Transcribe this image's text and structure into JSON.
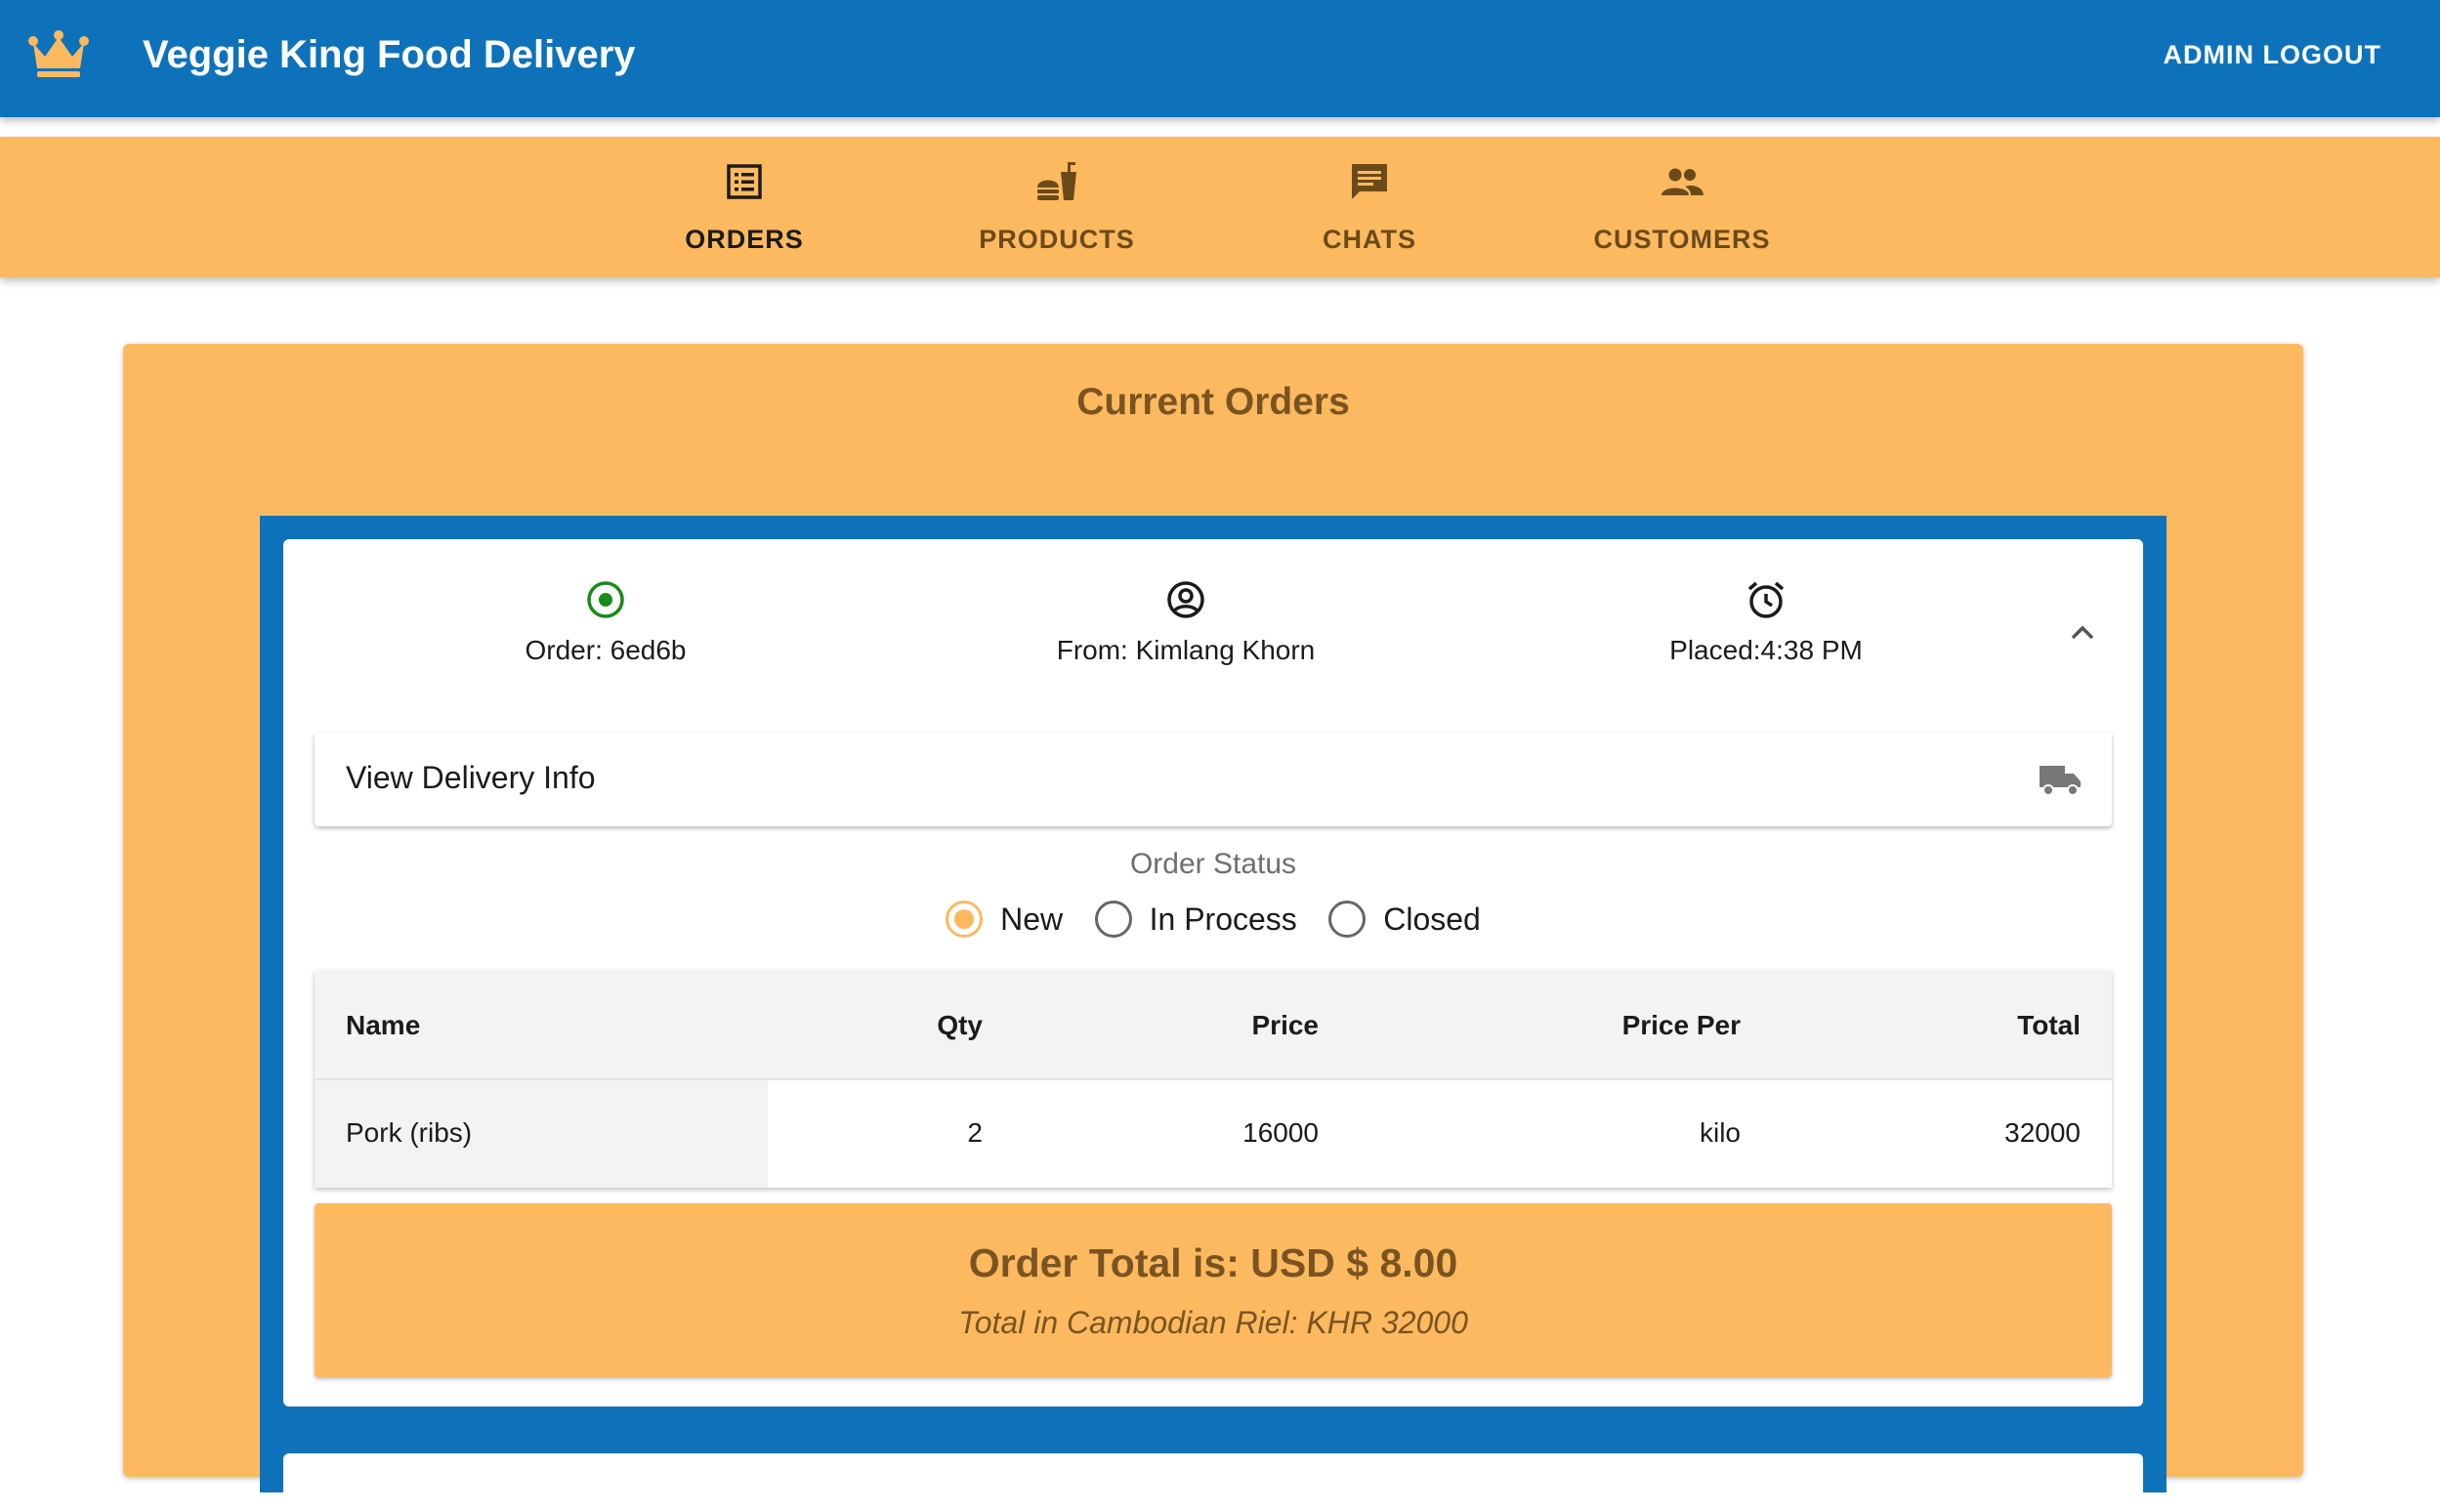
{
  "app": {
    "title": "Veggie King Food Delivery",
    "logo_icon": "crown-icon",
    "admin_label": "ADMIN",
    "logout_label": "LOGOUT",
    "brand_color": "#0e72bb",
    "accent_color": "#fdb960"
  },
  "tabs": [
    {
      "label": "ORDERS",
      "icon": "orders-list-icon",
      "active": true
    },
    {
      "label": "PRODUCTS",
      "icon": "fastfood-icon",
      "active": false
    },
    {
      "label": "CHATS",
      "icon": "chat-icon",
      "active": false
    },
    {
      "label": "CUSTOMERS",
      "icon": "people-icon",
      "active": false
    }
  ],
  "orders_panel": {
    "title": "Current Orders"
  },
  "order": {
    "id_text": "Order: 6ed6b",
    "from_text": "From: Kimlang Khorn",
    "placed_text": "Placed:4:38 PM",
    "delivery_label": "View Delivery Info",
    "status_label": "Order Status",
    "status_options": [
      "New",
      "In Process",
      "Closed"
    ],
    "selected_status": "New",
    "table": {
      "headers": [
        "Name",
        "Qty",
        "Price",
        "Price Per",
        "Total"
      ],
      "rows": [
        [
          "Pork (ribs)",
          "2",
          "16000",
          "kilo",
          "32000"
        ]
      ]
    },
    "total_text": "Order Total is: USD $ 8.00",
    "total_khr_text": "Total in Cambodian Riel: KHR 32000"
  }
}
